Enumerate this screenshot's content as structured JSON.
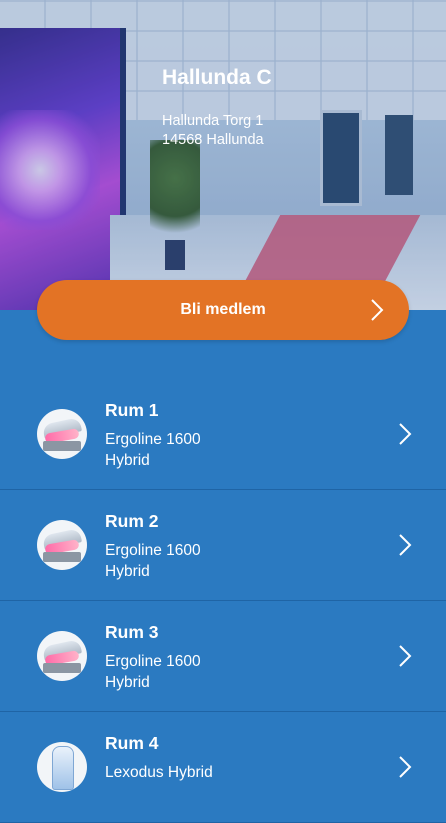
{
  "hero": {
    "title": "Hallunda C",
    "address_line1": "Hallunda Torg 1",
    "address_line2": "14568 Hallunda"
  },
  "cta": {
    "label": "Bli medlem",
    "color": "#e37325"
  },
  "rooms": [
    {
      "name": "Rum 1",
      "model": "Ergoline 1600 Hybrid",
      "icon": "tanning-bed-icon"
    },
    {
      "name": "Rum 2",
      "model": "Ergoline 1600 Hybrid",
      "icon": "tanning-bed-icon"
    },
    {
      "name": "Rum 3",
      "model": "Ergoline 1600 Hybrid",
      "icon": "tanning-bed-icon"
    },
    {
      "name": "Rum 4",
      "model": "Lexodus Hybrid",
      "icon": "standing-tanner-icon"
    }
  ],
  "colors": {
    "background": "#2b7ac1",
    "divider": "#1f64a5"
  }
}
